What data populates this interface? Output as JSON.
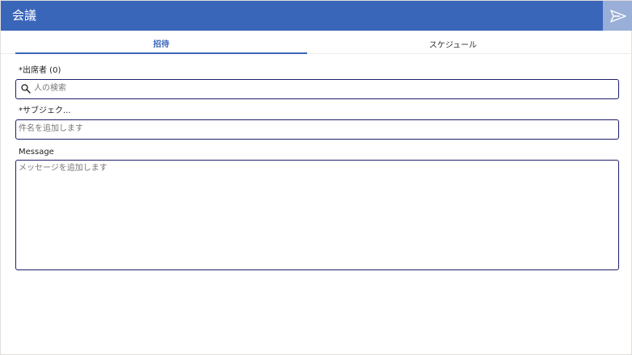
{
  "header": {
    "title": "会議",
    "send_icon": "send-icon",
    "colors": {
      "bar": "#3a66b9",
      "send_button": "#9aafd7"
    }
  },
  "tabs": [
    {
      "label": "招待",
      "selected": true
    },
    {
      "label": "スケジュール",
      "selected": false
    }
  ],
  "form": {
    "attendees": {
      "label": "*出席者 (0)",
      "placeholder": "人の検索",
      "icon": "search-icon",
      "value": ""
    },
    "subject": {
      "label": "*サブジェク...",
      "placeholder": "件名を追加します",
      "value": ""
    },
    "message": {
      "label": "Message",
      "placeholder": "メッセージを追加します",
      "value": ""
    }
  },
  "colors": {
    "accent": "#3a66b9",
    "field_border": "#1f1f6b"
  }
}
